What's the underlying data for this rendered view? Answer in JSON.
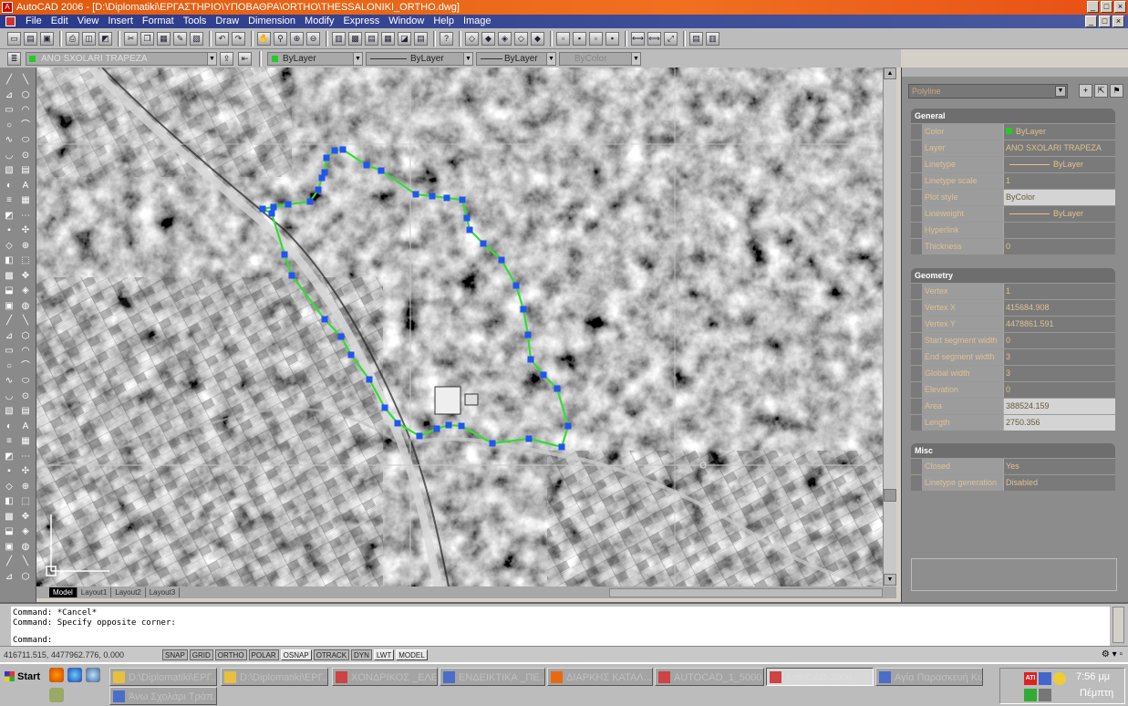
{
  "window": {
    "title": "AutoCAD 2006 - [D:\\Diplomatiki\\ΕΡΓΑΣΤΗΡΙΟ\\ΥΠΟΒΑΘΡΑ\\ORTHO\\THESSALONIKI_ORTHO.dwg]",
    "controls": [
      "_",
      "□",
      "×"
    ]
  },
  "menu": [
    "File",
    "Edit",
    "View",
    "Insert",
    "Format",
    "Tools",
    "Draw",
    "Dimension",
    "Modify",
    "Express",
    "Window",
    "Help",
    "Image"
  ],
  "layer_toolbar": {
    "layer": "ANO SXOLARI TRAPEZA",
    "color": "ByLayer",
    "linetype": "ByLayer",
    "lineweight": "ByLayer",
    "plotstyle": "ByColor"
  },
  "layout_tabs": [
    "Model",
    "Layout1",
    "Layout2",
    "Layout3"
  ],
  "properties": {
    "object_type": "Polyline",
    "sections": [
      {
        "title": "General",
        "rows": [
          {
            "name": "Color",
            "value": "ByLayer",
            "swatch": "#22cc22"
          },
          {
            "name": "Layer",
            "value": "ANO SXOLARI TRAPEZA"
          },
          {
            "name": "Linetype",
            "value": "ByLayer",
            "line": true
          },
          {
            "name": "Linetype scale",
            "value": "1"
          },
          {
            "name": "Plot style",
            "value": "ByColor",
            "highlight": true
          },
          {
            "name": "Lineweight",
            "value": "ByLayer",
            "line": true
          },
          {
            "name": "Hyperlink",
            "value": ""
          },
          {
            "name": "Thickness",
            "value": "0"
          }
        ]
      },
      {
        "title": "Geometry",
        "rows": [
          {
            "name": "Vertex",
            "value": "1"
          },
          {
            "name": "Vertex X",
            "value": "415684.908"
          },
          {
            "name": "Vertex Y",
            "value": "4478861.591"
          },
          {
            "name": "Start segment width",
            "value": "0"
          },
          {
            "name": "End segment width",
            "value": "3"
          },
          {
            "name": "Global width",
            "value": "3"
          },
          {
            "name": "Elevation",
            "value": "0"
          },
          {
            "name": "Area",
            "value": "388524.159",
            "highlight": true
          },
          {
            "name": "Length",
            "value": "2750.356",
            "highlight": true
          }
        ]
      },
      {
        "title": "Misc",
        "rows": [
          {
            "name": "Closed",
            "value": "Yes"
          },
          {
            "name": "Linetype generation",
            "value": "Disabled"
          }
        ]
      }
    ]
  },
  "command": {
    "line1": "Command: *Cancel*",
    "line2": "Command: Specify opposite corner:",
    "prompt": "Command:"
  },
  "status": {
    "coords": "416711.515, 4477962.776, 0.000",
    "toggles": [
      "SNAP",
      "GRID",
      "ORTHO",
      "POLAR",
      "OSNAP",
      "OTRACK",
      "DYN",
      "LWT",
      "MODEL"
    ],
    "active_toggles": [
      "OSNAP",
      "LWT",
      "MODEL"
    ]
  },
  "taskbar": {
    "start": "Start",
    "tasks": [
      {
        "label": "D:\\Diplomatiki\\ΕΡΓ...",
        "icon": "folder"
      },
      {
        "label": "D:\\Diplomatiki\\ΕΡΓ...",
        "icon": "folder"
      },
      {
        "label": "ΧΟΝΔΡΙΚΟΣ _ΕΛΕ...",
        "icon": "autocad"
      },
      {
        "label": "ΕΝΔΕΙΚΤΙΚΑ _ΠΕ...",
        "icon": "document"
      },
      {
        "label": "ΔΙΑΡΚΗΣ ΚΑΤΑΛ...",
        "icon": "firefox"
      },
      {
        "label": "AUTOCAD_1_5000...",
        "icon": "autocad"
      },
      {
        "label": "AutoCAD 2006 - ...",
        "icon": "autocad",
        "active": true
      },
      {
        "label": "Αγία Παρασκευή Κυ...",
        "icon": "document"
      },
      {
        "label": "Άνω Σχολάρι Τράπ...",
        "icon": "document"
      }
    ],
    "clock": "7:56 μμ",
    "day": "Πέμπτη"
  },
  "colors": {
    "polyline": "#33dd33",
    "grip": "#2255ee",
    "titlebar": "#e86a18",
    "menubar": "#2e3e8e"
  }
}
